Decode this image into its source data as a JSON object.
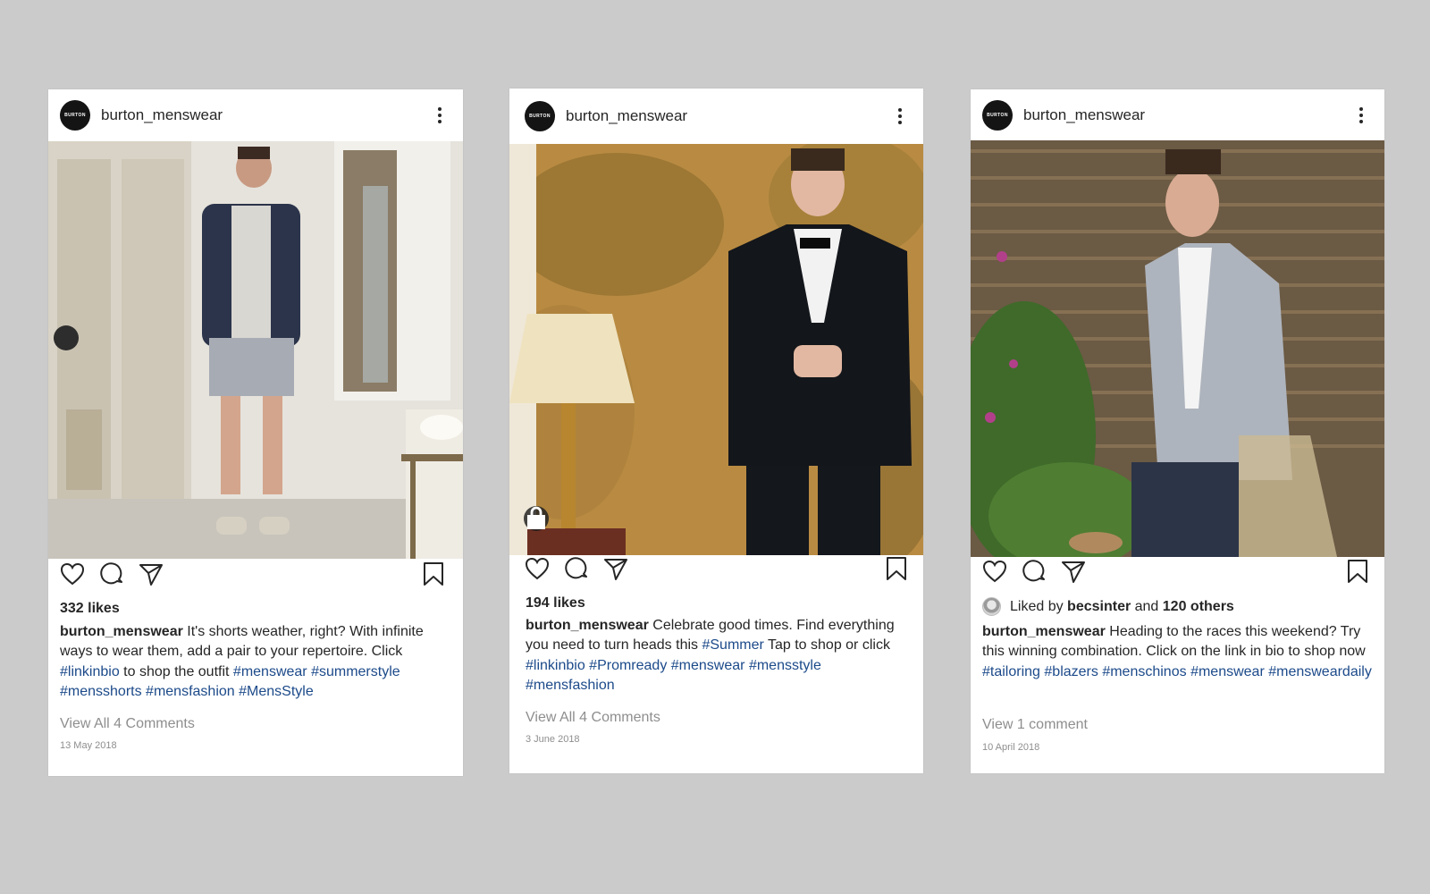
{
  "colors": {
    "background": "#cbcbcb",
    "hashtag": "#1c4a8a",
    "muted": "#8e8e8e",
    "text": "#262626"
  },
  "posts": [
    {
      "avatar_text": "BURTON",
      "username": "burton_menswear",
      "icons": [
        "more-vertical-icon",
        "heart-icon",
        "comment-icon",
        "share-icon",
        "bookmark-icon"
      ],
      "likes": "332 likes",
      "caption": {
        "user": "burton_menswear",
        "t1": " It's shorts weather, right? With infinite ways to wear them, add a pair to your repertoire. Click ",
        "h1": "#linkinbio",
        "t2": " to shop the outfit ",
        "h2": "#menswear",
        "h3": "#summerstyle",
        "h4": "#mensshorts",
        "h5": "#mensfashion",
        "h6": "#MensStyle"
      },
      "view_comments": "View All 4 Comments",
      "date": "13 May 2018"
    },
    {
      "avatar_text": "BURTON",
      "username": "burton_menswear",
      "icons": [
        "more-vertical-icon",
        "heart-icon",
        "comment-icon",
        "share-icon",
        "bookmark-icon",
        "shopping-bag-icon"
      ],
      "likes": "194 likes",
      "caption": {
        "user": "burton_menswear",
        "t1": " Celebrate good times. Find everything you need to turn heads this ",
        "h1": "#Summer",
        "t2": " Tap to shop or click ",
        "h2": "#linkinbio",
        "h3": "#Promready",
        "h4": "#menswear",
        "h5": "#mensstyle",
        "h6": "#mensfashion"
      },
      "view_comments": "View All 4 Comments",
      "date": "3 June 2018"
    },
    {
      "avatar_text": "BURTON",
      "username": "burton_menswear",
      "icons": [
        "more-vertical-icon",
        "heart-icon",
        "comment-icon",
        "share-icon",
        "bookmark-icon"
      ],
      "liked_by": {
        "prefix": "Liked by ",
        "user": "becsinter",
        "middle": " and ",
        "others": "120 others"
      },
      "caption": {
        "user": "burton_menswear",
        "t1": " Heading to the races this weekend? Try this winning combination. Click on the link in bio to shop now ",
        "h1": "#tailoring",
        "h2": "#blazers",
        "h3": "#menschinos",
        "h4": "#menswear",
        "h5": "#mensweardaily"
      },
      "view_comments": "View 1 comment",
      "date": "10 April 2018"
    }
  ]
}
